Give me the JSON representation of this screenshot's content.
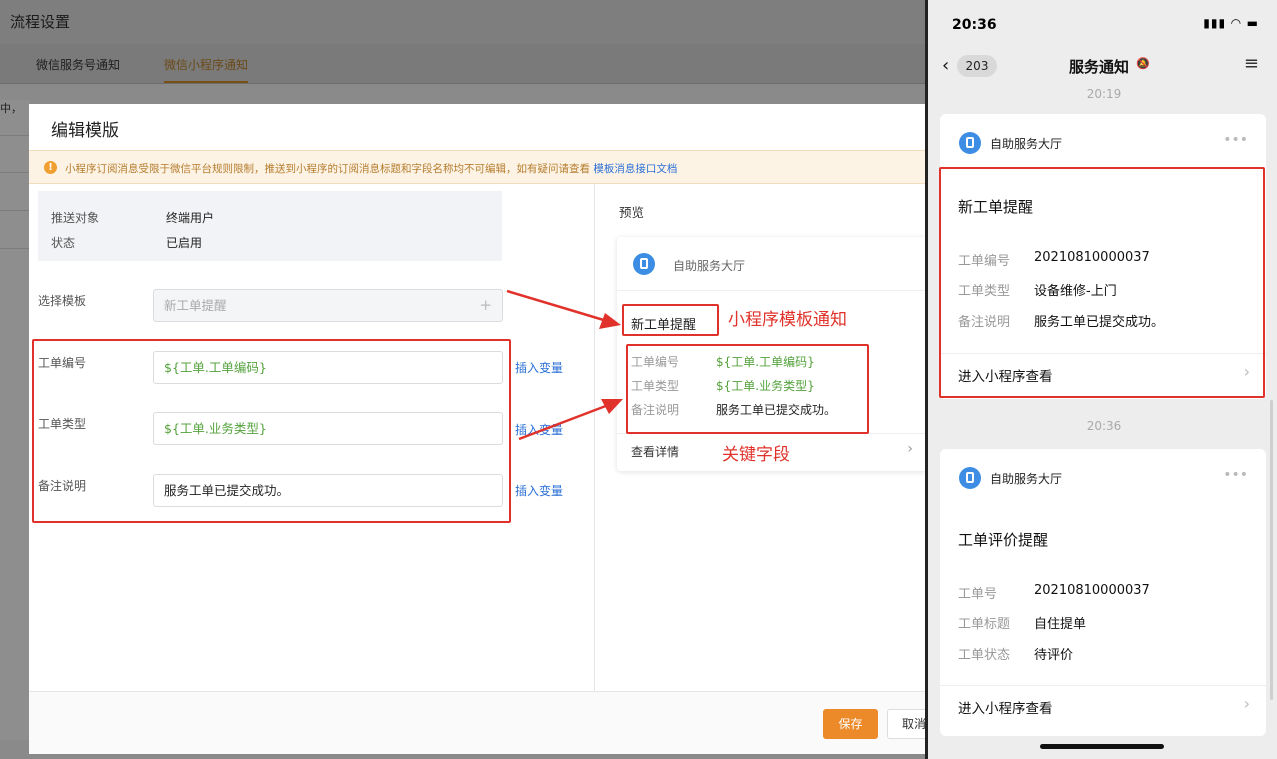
{
  "admin": {
    "page_title": "流程设置",
    "tabs": [
      "微信服务号通知",
      "微信小程序通知"
    ],
    "bg_hint": "中，"
  },
  "modal": {
    "title": "编辑模版",
    "notice_text": "小程序订阅消息受限于微信平台规则限制，推送到小程序的订阅消息标题和字段名称均不可编辑，如有疑问请查看",
    "notice_link": "模板消息接口文档",
    "info": [
      {
        "label": "推送对象",
        "value": "终端用户"
      },
      {
        "label": "状态",
        "value": "已启用"
      }
    ],
    "select_template": {
      "label": "选择模板",
      "value": "新工单提醒",
      "icon": "plus-icon"
    },
    "fields": [
      {
        "label": "工单编号",
        "value": "${工单.工单编码}",
        "action": "插入变量"
      },
      {
        "label": "工单类型",
        "value": "${工单.业务类型}",
        "action": "插入变量"
      },
      {
        "label": "备注说明",
        "value": "服务工单已提交成功。",
        "action": "插入变量"
      }
    ],
    "preview": {
      "label": "预览",
      "app_name": "自助服务大厅",
      "title": "新工单提醒",
      "rows": [
        {
          "label": "工单编号",
          "value": "${工单.工单编码}"
        },
        {
          "label": "工单类型",
          "value": "${工单.业务类型}"
        },
        {
          "label": "备注说明",
          "value": "服务工单已提交成功。"
        }
      ],
      "detail": "查看详情"
    },
    "annotations": {
      "template_notice": "小程序模板通知",
      "key_fields": "关键字段"
    },
    "save": "保存",
    "cancel": "取消"
  },
  "phone": {
    "time": "20:36",
    "back_badge": "203",
    "nav_title": "服务通知",
    "timestamps": [
      "20:19",
      "20:36"
    ],
    "cards": [
      {
        "app_name": "自助服务大厅",
        "title": "新工单提醒",
        "rows": [
          {
            "label": "工单编号",
            "value": "20210810000037"
          },
          {
            "label": "工单类型",
            "value": "设备维修-上门"
          },
          {
            "label": "备注说明",
            "value": "服务工单已提交成功。"
          }
        ],
        "enter": "进入小程序查看"
      },
      {
        "app_name": "自助服务大厅",
        "title": "工单评价提醒",
        "rows": [
          {
            "label": "工单号",
            "value": "20210810000037"
          },
          {
            "label": "工单标题",
            "value": "自住提单"
          },
          {
            "label": "工单状态",
            "value": "待评价"
          }
        ],
        "enter": "进入小程序查看"
      }
    ]
  },
  "colors": {
    "accent": "#ec8a2a",
    "link": "#2a6fd6",
    "annotation_red": "#e0322b",
    "variable_green": "#54a23c"
  }
}
